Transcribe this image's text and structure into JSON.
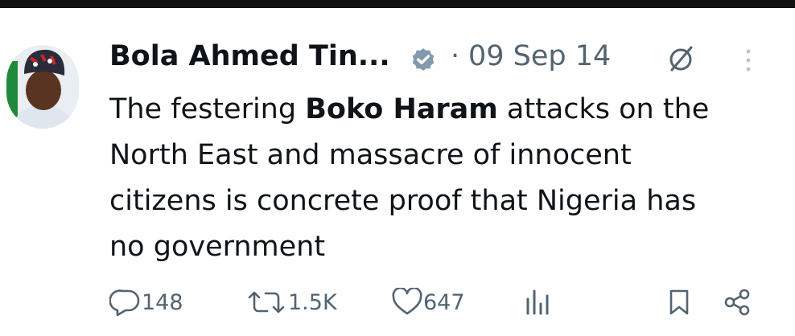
{
  "tweet": {
    "author_name": "Bola Ahmed Tin...",
    "separator": "·",
    "date": "09 Sep 14",
    "text_parts": [
      "The festering ",
      "Boko Haram",
      " attacks on the",
      "North East and massacre of innocent",
      "citizens is concrete proof that Nigeria has",
      "no government"
    ]
  },
  "actions": {
    "replies": "148",
    "reposts": "1.5K",
    "likes": "647"
  },
  "icons": [
    "verified-badge-icon",
    "grok-icon",
    "more-icon",
    "reply-icon",
    "repost-icon",
    "like-icon",
    "views-icon",
    "bookmark-icon",
    "share-icon"
  ],
  "colors": {
    "text": "#0f1419",
    "muted": "#536471",
    "verified_badge": "#829aab"
  }
}
